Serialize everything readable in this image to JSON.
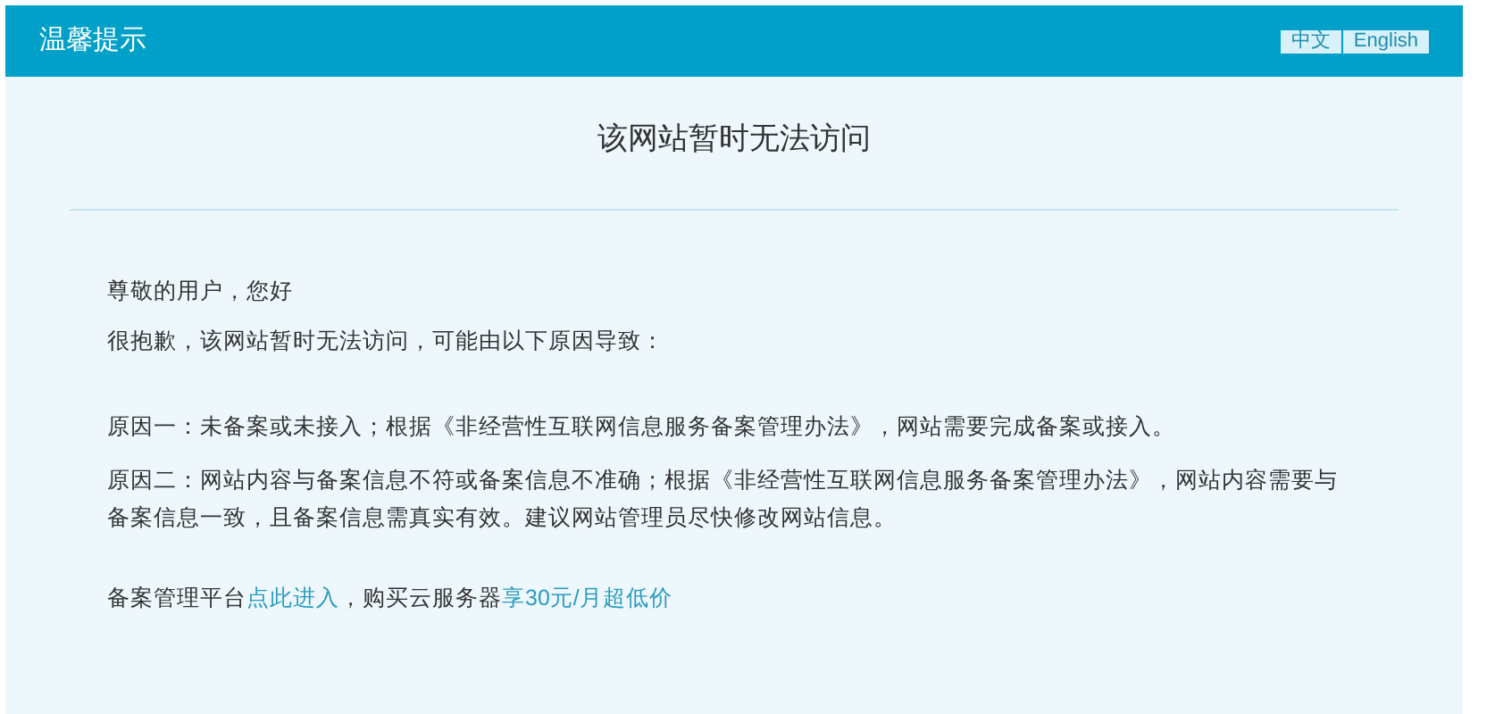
{
  "header": {
    "title": "温馨提示",
    "languages": [
      {
        "label": "中文"
      },
      {
        "label": "English"
      }
    ]
  },
  "heading": "该网站暂时无法访问",
  "greeting": "尊敬的用户，您好",
  "intro": "很抱歉，该网站暂时无法访问，可能由以下原因导致：",
  "reasons": [
    "原因一：未备案或未接入；根据《非经营性互联网信息服务备案管理办法》，网站需要完成备案或接入。",
    "原因二：网站内容与备案信息不符或备案信息不准确；根据《非经营性互联网信息服务备案管理办法》，网站内容需要与备案信息一致，且备案信息需真实有效。建议网站管理员尽快修改网站信息。"
  ],
  "footer": [
    {
      "kind": "text",
      "text": "备案管理平台"
    },
    {
      "kind": "link",
      "text": "点此进入"
    },
    {
      "kind": "text",
      "text": "，购买云服务器"
    },
    {
      "kind": "link",
      "text": "享30元/月超低价"
    }
  ]
}
